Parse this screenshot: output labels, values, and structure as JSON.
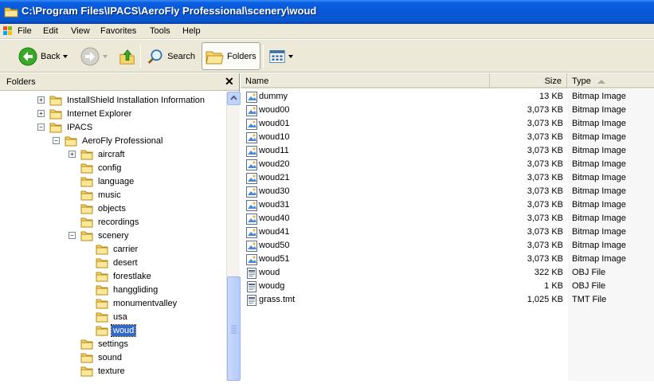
{
  "window": {
    "title": "C:\\Program Files\\IPACS\\AeroFly Professional\\scenery\\woud"
  },
  "menu": [
    "File",
    "Edit",
    "View",
    "Favorites",
    "Tools",
    "Help"
  ],
  "toolbar": {
    "back": "Back",
    "search": "Search",
    "folders": "Folders"
  },
  "folders_pane": {
    "title": "Folders",
    "close": "✕"
  },
  "tree": [
    {
      "label": "InstallShield Installation Information",
      "level": 0,
      "expander": "+",
      "selected": false
    },
    {
      "label": "Internet Explorer",
      "level": 0,
      "expander": "+",
      "selected": false
    },
    {
      "label": "IPACS",
      "level": 0,
      "expander": "−",
      "selected": false
    },
    {
      "label": "AeroFly Professional",
      "level": 1,
      "expander": "−",
      "selected": false
    },
    {
      "label": "aircraft",
      "level": 2,
      "expander": "+",
      "selected": false
    },
    {
      "label": "config",
      "level": 2,
      "expander": "",
      "selected": false
    },
    {
      "label": "language",
      "level": 2,
      "expander": "",
      "selected": false
    },
    {
      "label": "music",
      "level": 2,
      "expander": "",
      "selected": false
    },
    {
      "label": "objects",
      "level": 2,
      "expander": "",
      "selected": false
    },
    {
      "label": "recordings",
      "level": 2,
      "expander": "",
      "selected": false
    },
    {
      "label": "scenery",
      "level": 2,
      "expander": "−",
      "selected": false
    },
    {
      "label": "carrier",
      "level": 3,
      "expander": "",
      "selected": false
    },
    {
      "label": "desert",
      "level": 3,
      "expander": "",
      "selected": false
    },
    {
      "label": "forestlake",
      "level": 3,
      "expander": "",
      "selected": false
    },
    {
      "label": "hanggliding",
      "level": 3,
      "expander": "",
      "selected": false
    },
    {
      "label": "monumentvalley",
      "level": 3,
      "expander": "",
      "selected": false
    },
    {
      "label": "usa",
      "level": 3,
      "expander": "",
      "selected": false
    },
    {
      "label": "woud",
      "level": 3,
      "expander": "",
      "selected": true
    },
    {
      "label": "settings",
      "level": 2,
      "expander": "",
      "selected": false
    },
    {
      "label": "sound",
      "level": 2,
      "expander": "",
      "selected": false
    },
    {
      "label": "texture",
      "level": 2,
      "expander": "",
      "selected": false
    }
  ],
  "columns": {
    "name": "Name",
    "size": "Size",
    "type": "Type"
  },
  "files": [
    {
      "name": "dummy",
      "size": "13 KB",
      "type": "Bitmap Image",
      "icon": "bitmap"
    },
    {
      "name": "woud00",
      "size": "3,073 KB",
      "type": "Bitmap Image",
      "icon": "bitmap"
    },
    {
      "name": "woud01",
      "size": "3,073 KB",
      "type": "Bitmap Image",
      "icon": "bitmap"
    },
    {
      "name": "woud10",
      "size": "3,073 KB",
      "type": "Bitmap Image",
      "icon": "bitmap"
    },
    {
      "name": "woud11",
      "size": "3,073 KB",
      "type": "Bitmap Image",
      "icon": "bitmap"
    },
    {
      "name": "woud20",
      "size": "3,073 KB",
      "type": "Bitmap Image",
      "icon": "bitmap"
    },
    {
      "name": "woud21",
      "size": "3,073 KB",
      "type": "Bitmap Image",
      "icon": "bitmap"
    },
    {
      "name": "woud30",
      "size": "3,073 KB",
      "type": "Bitmap Image",
      "icon": "bitmap"
    },
    {
      "name": "woud31",
      "size": "3,073 KB",
      "type": "Bitmap Image",
      "icon": "bitmap"
    },
    {
      "name": "woud40",
      "size": "3,073 KB",
      "type": "Bitmap Image",
      "icon": "bitmap"
    },
    {
      "name": "woud41",
      "size": "3,073 KB",
      "type": "Bitmap Image",
      "icon": "bitmap"
    },
    {
      "name": "woud50",
      "size": "3,073 KB",
      "type": "Bitmap Image",
      "icon": "bitmap"
    },
    {
      "name": "woud51",
      "size": "3,073 KB",
      "type": "Bitmap Image",
      "icon": "bitmap"
    },
    {
      "name": "woud",
      "size": "322 KB",
      "type": "OBJ File",
      "icon": "generic"
    },
    {
      "name": "woudg",
      "size": "1 KB",
      "type": "OBJ File",
      "icon": "generic"
    },
    {
      "name": "grass.tmt",
      "size": "1,025 KB",
      "type": "TMT File",
      "icon": "generic"
    }
  ],
  "colors": {
    "titlebar": "#0758d8",
    "selection": "#316ac5",
    "folder": "#f5d66b",
    "chrome": "#ece9d8"
  }
}
